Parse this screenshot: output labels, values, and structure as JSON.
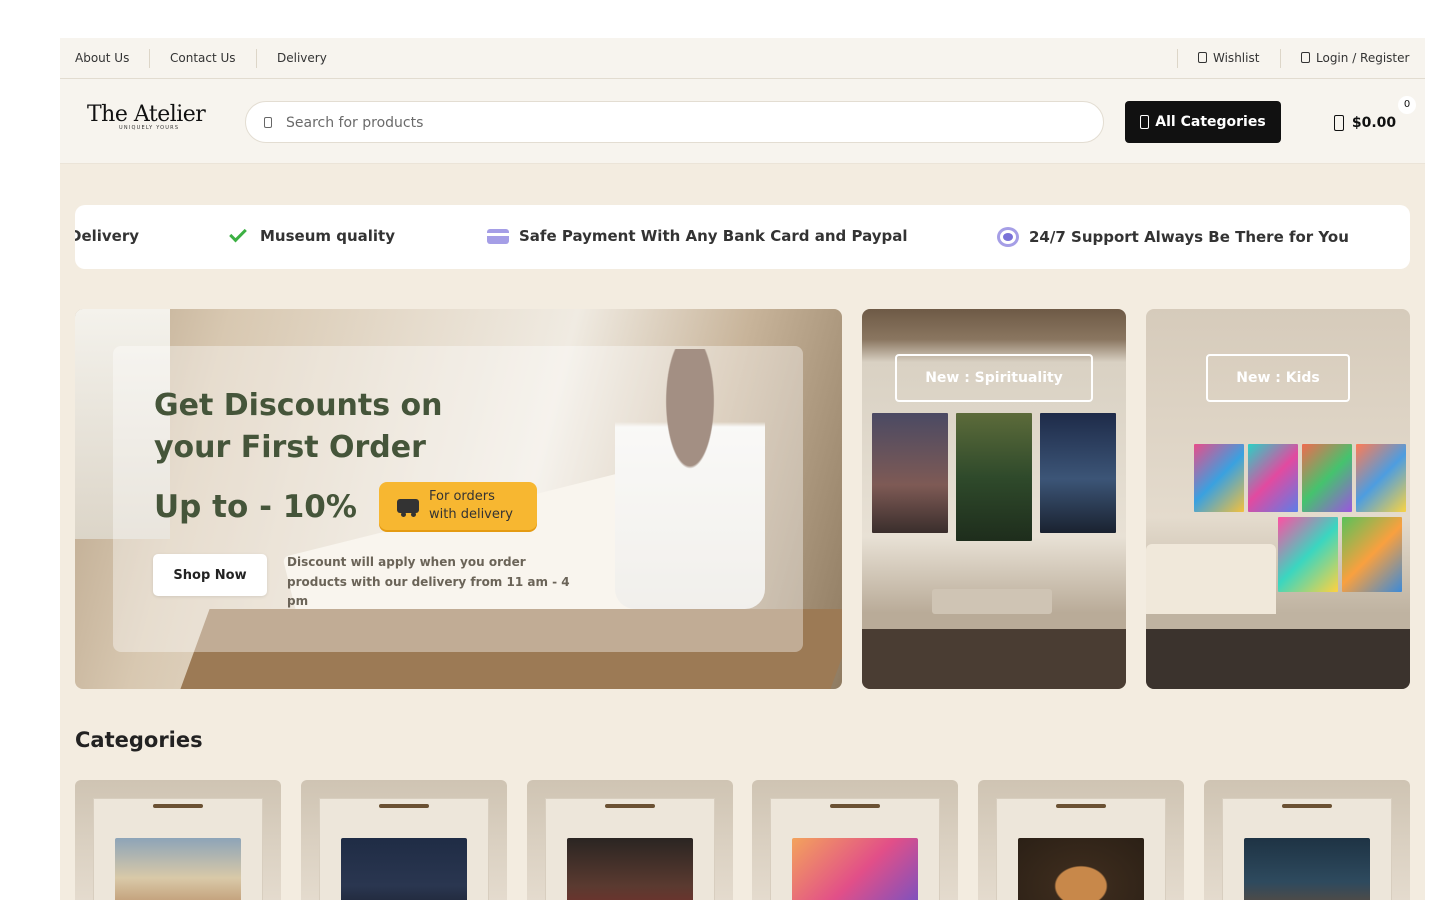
{
  "topbar": {
    "links": [
      "About Us",
      "Contact Us",
      "Delivery"
    ],
    "wishlist": "Wishlist",
    "login": "Login / Register"
  },
  "header": {
    "logo_main": "The Atelier",
    "logo_sub": "UNIQUELY YOURS",
    "search_placeholder": "Search for products",
    "categories_button": "All Categories",
    "cart_total": "$0.00",
    "cart_count": "0"
  },
  "features": [
    {
      "label": "Delivery",
      "icon": "truck-icon"
    },
    {
      "label": "Museum quality",
      "icon": "check-icon"
    },
    {
      "label": "Safe Payment With Any Bank Card and Paypal",
      "icon": "credit-card-icon"
    },
    {
      "label": "24/7 Support Always Be There for You",
      "icon": "support-icon"
    }
  ],
  "hero": {
    "title": "Get Discounts on your First Order",
    "discount": "Up to - 10%",
    "badge": "For orders with delivery",
    "button": "Shop Now",
    "note": "Discount will apply when you order products with our delivery from 11 am - 4 pm"
  },
  "promos": [
    {
      "label": "New : Spirituality"
    },
    {
      "label": "New : Kids"
    }
  ],
  "categories": {
    "title": "Categories"
  },
  "colors": {
    "accent": "#45553a",
    "badge": "#f7b731",
    "background": "#f3ece0",
    "button_dark": "#111111"
  }
}
